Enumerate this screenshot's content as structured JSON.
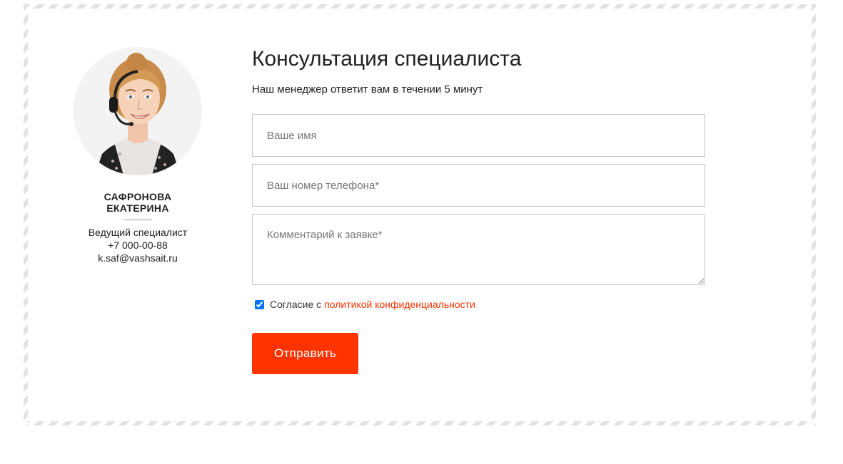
{
  "colors": {
    "accent": "#ff3300",
    "border": "#c6c6c6",
    "frame_stripe": "#e2e2e2",
    "text": "#222222"
  },
  "manager": {
    "avatar_icon": "operator-headset-photo",
    "name_line1": "САФРОНОВА",
    "name_line2": "ЕКАТЕРИНА",
    "role": "Ведущий специалист",
    "phone": "+7 000-00-88",
    "email": "k.saf@vashsait.ru"
  },
  "form": {
    "title": "Консультация специалиста",
    "subtitle": "Наш менеджер ответит вам в течении 5 минут",
    "name_placeholder": "Ваше имя",
    "phone_placeholder": "Ваш номер телефона*",
    "comment_placeholder": "Комментарий к заявке*",
    "consent_checked": true,
    "consent_text": "Согласие с",
    "consent_link": "политикой конфиденциальности",
    "submit_label": "Отправить"
  }
}
